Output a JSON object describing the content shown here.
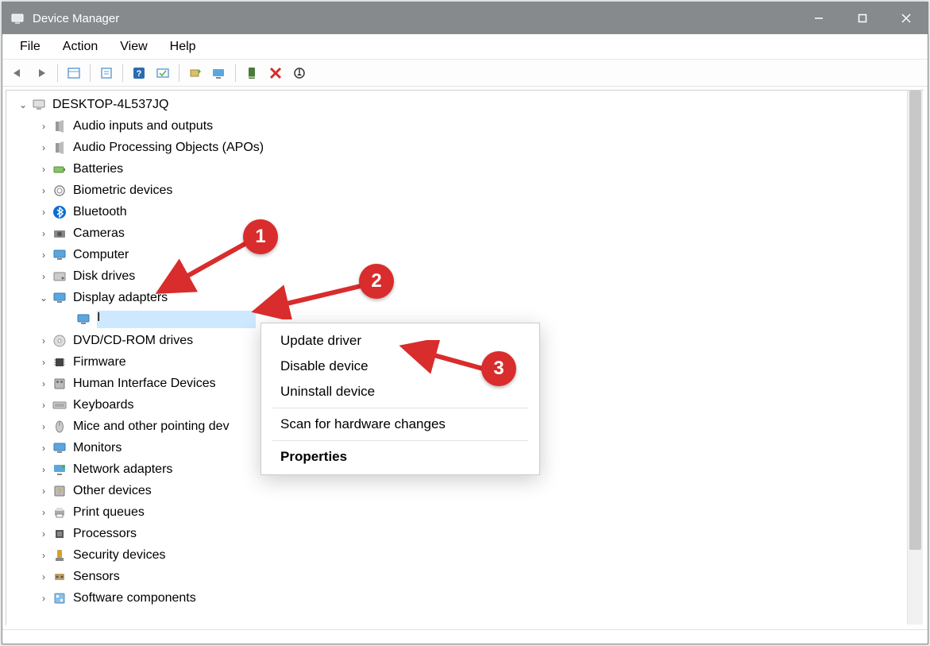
{
  "window": {
    "title": "Device Manager"
  },
  "menubar": [
    "File",
    "Action",
    "View",
    "Help"
  ],
  "tree": {
    "root": "DESKTOP-4L537JQ",
    "categories": [
      {
        "label": "Audio inputs and outputs",
        "icon": "speaker"
      },
      {
        "label": "Audio Processing Objects (APOs)",
        "icon": "speaker"
      },
      {
        "label": "Batteries",
        "icon": "battery"
      },
      {
        "label": "Biometric devices",
        "icon": "finger"
      },
      {
        "label": "Bluetooth",
        "icon": "bluetooth"
      },
      {
        "label": "Cameras",
        "icon": "camera"
      },
      {
        "label": "Computer",
        "icon": "monitor"
      },
      {
        "label": "Disk drives",
        "icon": "disk"
      },
      {
        "label": "Display adapters",
        "icon": "display",
        "expanded": true,
        "children": [
          {
            "label": "I",
            "selected": true
          }
        ]
      },
      {
        "label": "DVD/CD-ROM drives",
        "icon": "dvd"
      },
      {
        "label": "Firmware",
        "icon": "chip"
      },
      {
        "label": "Human Interface Devices",
        "icon": "hid"
      },
      {
        "label": "Keyboards",
        "icon": "keyboard"
      },
      {
        "label": "Mice and other pointing dev",
        "icon": "mouse"
      },
      {
        "label": "Monitors",
        "icon": "monitor"
      },
      {
        "label": "Network adapters",
        "icon": "network"
      },
      {
        "label": "Other devices",
        "icon": "other"
      },
      {
        "label": "Print queues",
        "icon": "printer"
      },
      {
        "label": "Processors",
        "icon": "cpu"
      },
      {
        "label": "Security devices",
        "icon": "security"
      },
      {
        "label": "Sensors",
        "icon": "sensor"
      },
      {
        "label": "Software components",
        "icon": "software"
      }
    ]
  },
  "context_menu": {
    "items": [
      {
        "label": "Update driver"
      },
      {
        "label": "Disable device"
      },
      {
        "label": "Uninstall device"
      },
      {
        "divider": true
      },
      {
        "label": "Scan for hardware changes"
      },
      {
        "divider": true
      },
      {
        "label": "Properties",
        "bold": true
      }
    ]
  },
  "annotations": {
    "b1": "1",
    "b2": "2",
    "b3": "3"
  }
}
